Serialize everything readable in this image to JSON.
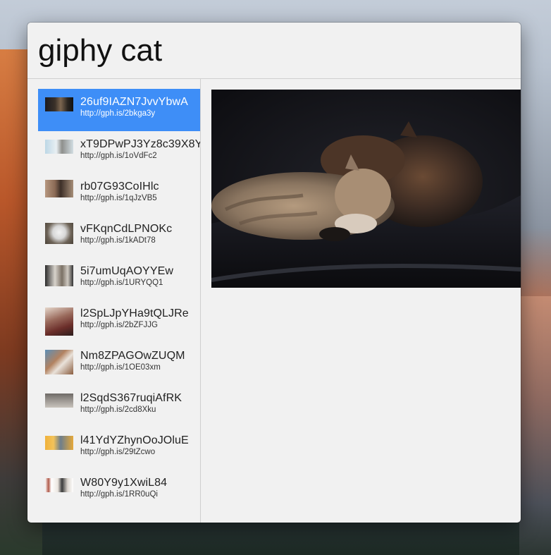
{
  "search": {
    "query": "giphy cat"
  },
  "results": [
    {
      "id": "26uf9IAZN7JvvYbwA",
      "url": "http://gph.is/2bkga3y",
      "thumb": "cat-dark-gif-thumbnail",
      "selected": true
    },
    {
      "id": "xT9DPwPJ3Yz8c39X8Y",
      "url": "http://gph.is/1oVdFc2",
      "thumb": "cat-light-gif-thumbnail",
      "selected": false
    },
    {
      "id": "rb07G93CoIHlc",
      "url": "http://gph.is/1qJzVB5",
      "thumb": "cat-brown-gif-thumbnail",
      "selected": false
    },
    {
      "id": "vFKqnCdLPNOKc",
      "url": "http://gph.is/1kADt78",
      "thumb": "cat-white-gif-thumbnail",
      "selected": false
    },
    {
      "id": "5i7umUqAOYYEw",
      "url": "http://gph.is/1URYQQ1",
      "thumb": "cat-tabby-gif-thumbnail",
      "selected": false
    },
    {
      "id": "l2SpLJpYHa9tQLJRe",
      "url": "http://gph.is/2bZFJJG",
      "thumb": "cat-red-gif-thumbnail",
      "selected": false
    },
    {
      "id": "Nm8ZPAGOwZUQM",
      "url": "http://gph.is/1OE03xm",
      "thumb": "cat-calico-gif-thumbnail",
      "selected": false
    },
    {
      "id": "l2SqdS367ruqiAfRK",
      "url": "http://gph.is/2cd8Xku",
      "thumb": "cat-gray-gif-thumbnail",
      "selected": false
    },
    {
      "id": "l41YdYZhynOoJOluE",
      "url": "http://gph.is/29tZcwo",
      "thumb": "cat-orange-gif-thumbnail",
      "selected": false
    },
    {
      "id": "W80Y9y1XwiL84",
      "url": "http://gph.is/1RR0uQi",
      "thumb": "cat-bw-gif-thumbnail",
      "selected": false
    }
  ],
  "colors": {
    "selection": "#3e8ef7",
    "window_bg": "#f1f1f1",
    "divider": "#cfcfcf"
  }
}
